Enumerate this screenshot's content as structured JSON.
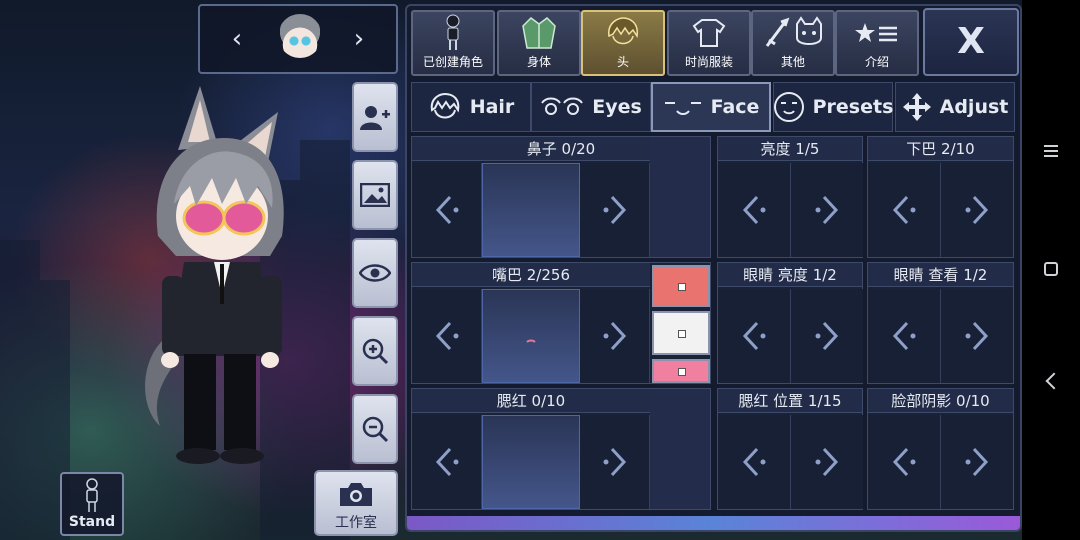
{
  "header": {
    "prev_char": "‹",
    "next_char": "›"
  },
  "tools": {
    "add_user": "add-user-icon",
    "background": "image-icon",
    "visibility": "eye-icon",
    "zoom_in": "zoom-in-icon",
    "zoom_out": "zoom-out-icon",
    "studio_label": "工作室",
    "stand_label": "Stand"
  },
  "category_tabs": [
    {
      "label": "已创建角色",
      "icon": "figure-icon"
    },
    {
      "label": "身体",
      "icon": "jacket-icon"
    },
    {
      "label": "头",
      "icon": "hair-icon",
      "active": true
    },
    {
      "label": "时尚服装",
      "icon": "shirt-icon"
    },
    {
      "label": "其他",
      "icon": "sword-cat-icon"
    },
    {
      "label": "介绍",
      "icon": "star-list-icon"
    }
  ],
  "close_label": "X",
  "sub_tabs": [
    {
      "label": "Hair"
    },
    {
      "label": "Eyes"
    },
    {
      "label": "Face",
      "active": true
    },
    {
      "label": "Presets"
    },
    {
      "label": "Adjust"
    }
  ],
  "options": {
    "nose": "鼻子 0/20",
    "brightness": "亮度 1/5",
    "chin": "下巴 2/10",
    "mouth": "嘴巴 2/256",
    "eye_brightness": "眼睛 亮度 1/2",
    "eye_look": "眼睛 查看 1/2",
    "blush": "腮红 0/10",
    "blush_pos": "腮红 位置 1/15",
    "face_shadow": "脸部阴影 0/10"
  },
  "mouth_colors": [
    "#e8736f",
    "#f2f2f2",
    "#f07fa0"
  ],
  "colors": {
    "accent_active_tab": "#b09a4c",
    "panel_bg": "#141b2e"
  }
}
